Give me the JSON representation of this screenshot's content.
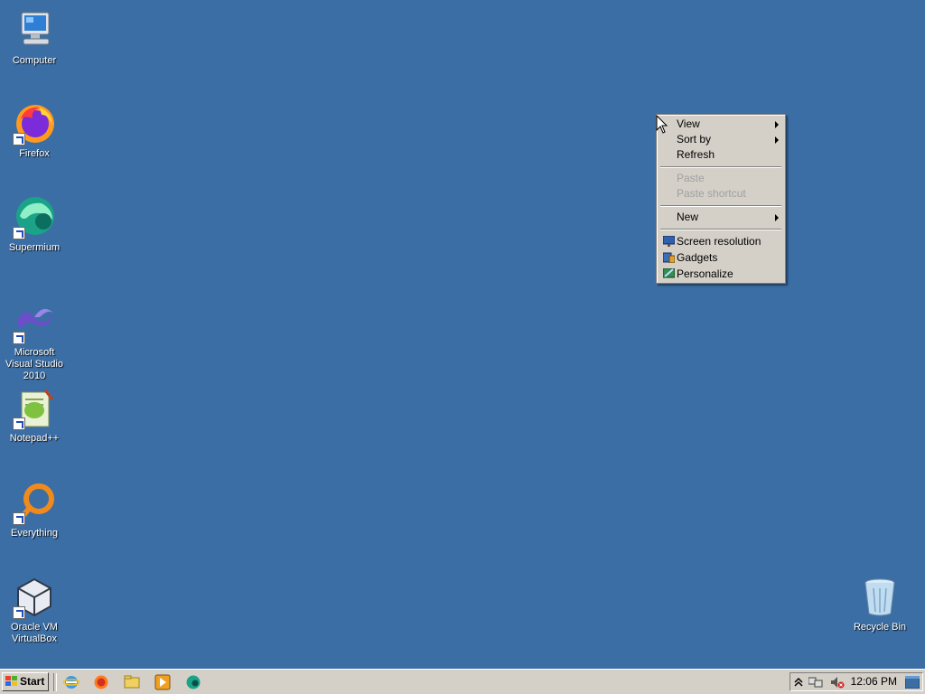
{
  "desktop": {
    "icons": [
      {
        "label": "Computer",
        "icon": "computer-icon"
      },
      {
        "label": "Firefox",
        "icon": "firefox-icon"
      },
      {
        "label": "Supermium",
        "icon": "supermium-icon"
      },
      {
        "label": "Microsoft Visual Studio 2010",
        "icon": "visual-studio-icon"
      },
      {
        "label": "Notepad++",
        "icon": "notepadpp-icon"
      },
      {
        "label": "Everything",
        "icon": "everything-icon"
      },
      {
        "label": "Oracle VM VirtualBox",
        "icon": "virtualbox-icon"
      },
      {
        "label": "Recycle Bin",
        "icon": "recycle-bin-icon"
      }
    ]
  },
  "context_menu": {
    "view": "View",
    "sort_by": "Sort by",
    "refresh": "Refresh",
    "paste": "Paste",
    "paste_shortcut": "Paste shortcut",
    "new": "New",
    "screen_resolution": "Screen resolution",
    "gadgets": "Gadgets",
    "personalize": "Personalize"
  },
  "taskbar": {
    "start_label": "Start",
    "quick_launch": [
      "ie-icon",
      "firefox-icon",
      "explorer-icon",
      "media-player-icon",
      "supermium-icon"
    ],
    "clock": "12:06 PM"
  },
  "colors": {
    "desktop": "#3b6ea5",
    "menu_bg": "#d4d0c8",
    "disabled_text": "#a0a0a0"
  }
}
